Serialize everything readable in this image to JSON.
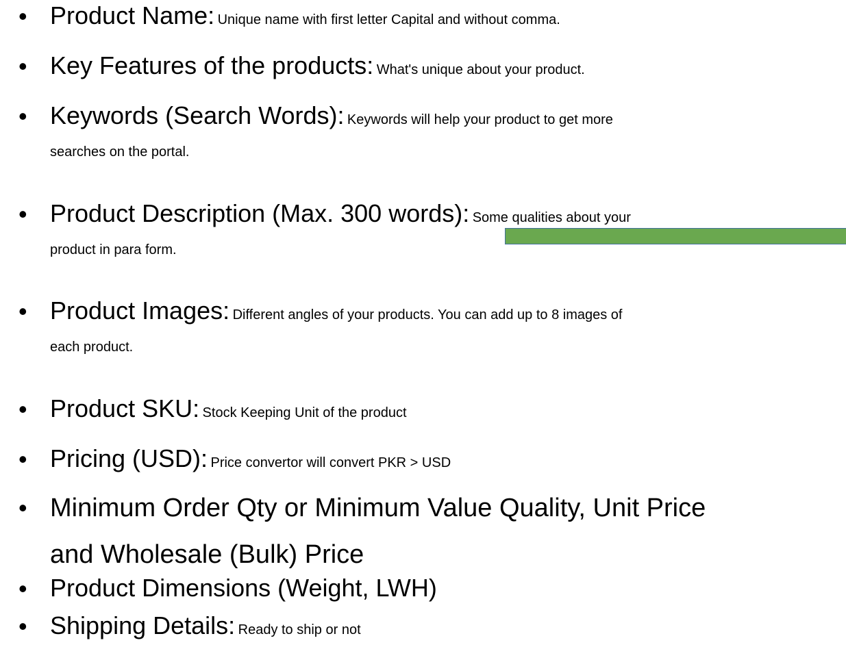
{
  "bullet_symbol": "•",
  "items": [
    {
      "heading": "Product Name:",
      "desc": "Unique name with first letter Capital and without comma."
    },
    {
      "heading": "Key Features of the products:",
      "desc": "What's unique about your product."
    },
    {
      "heading": "Keywords (Search Words):",
      "desc": "Keywords will help your product to get more",
      "desc_cont": "searches on the portal."
    },
    {
      "heading": "Product Description (Max. 300 words):",
      "desc": "Some qualities about your",
      "desc_cont": "product in para form."
    },
    {
      "heading": "Product Images:",
      "desc": "Different angles of your products. You can add up to 8 images of",
      "desc_cont": "each product."
    },
    {
      "heading": "Product SKU:",
      "desc": "Stock Keeping Unit of the product"
    },
    {
      "heading": "Pricing (USD):",
      "desc": "Price convertor will convert PKR > USD"
    },
    {
      "heading_line1": "Minimum Order Qty or Minimum Value Quality, Unit Price",
      "heading_line2": "and Wholesale (Bulk) Price"
    },
    {
      "heading": "Product Dimensions (Weight, LWH)"
    },
    {
      "heading": "Shipping Details:",
      "desc": "Ready to ship or not"
    }
  ],
  "colors": {
    "text": "#000000",
    "highlight_bar": "#6aa84f",
    "highlight_bar_border": "#41719c"
  }
}
